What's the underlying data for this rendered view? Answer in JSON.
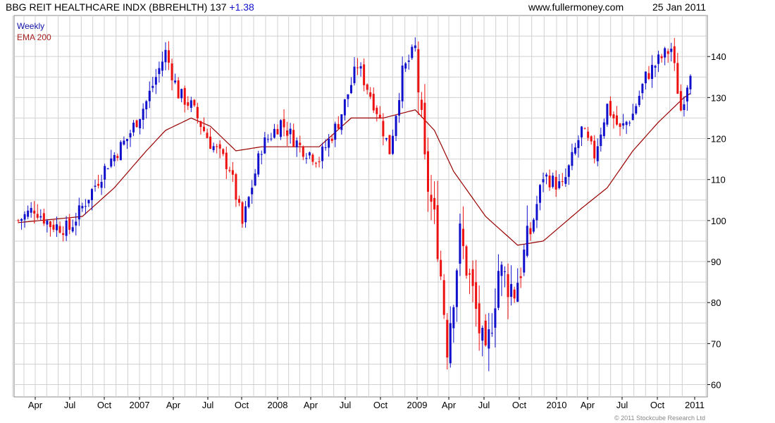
{
  "header": {
    "title": "BBG REIT HEALTHCARE INDX (BBREHLTH) 137",
    "change": "+1.38",
    "site": "www.fullermoney.com",
    "date": "25 Jan 2011"
  },
  "footer": {
    "copyright": "© 2011 Stockcube Research Ltd"
  },
  "colors": {
    "up": "#1010cc",
    "down": "#ee1111",
    "ema": "#990000",
    "grid": "#d0d0d0",
    "legend_weekly": "#1111aa",
    "legend_ema": "#aa2222"
  },
  "chart_data": {
    "type": "candlestick",
    "period": "Weekly",
    "legend": [
      {
        "label": "Weekly",
        "color": "#1111aa"
      },
      {
        "label": "EMA 200",
        "color": "#aa2222"
      }
    ],
    "y_ticks": [
      60,
      70,
      80,
      90,
      100,
      110,
      120,
      130,
      140
    ],
    "ylim": [
      57,
      150
    ],
    "x_tick_labels": [
      "Apr",
      "Jul",
      "Oct",
      "2007",
      "Apr",
      "Jul",
      "Oct",
      "2008",
      "Apr",
      "Jul",
      "Oct",
      "2009",
      "Apr",
      "Jul",
      "Oct",
      "2010",
      "Apr",
      "Jul",
      "Oct",
      "2011"
    ],
    "x_anchor_points": [
      {
        "week": 0,
        "close": 100
      },
      {
        "week": 5,
        "close": 103
      },
      {
        "week": 10,
        "close": 99
      },
      {
        "week": 16,
        "close": 98
      },
      {
        "week": 22,
        "close": 106
      },
      {
        "week": 28,
        "close": 114
      },
      {
        "week": 34,
        "close": 120
      },
      {
        "week": 40,
        "close": 129
      },
      {
        "week": 46,
        "close": 141
      },
      {
        "week": 50,
        "close": 131
      },
      {
        "week": 54,
        "close": 128
      },
      {
        "week": 60,
        "close": 119
      },
      {
        "week": 66,
        "close": 113
      },
      {
        "week": 70,
        "close": 99
      },
      {
        "week": 76,
        "close": 118
      },
      {
        "week": 82,
        "close": 124
      },
      {
        "week": 88,
        "close": 118
      },
      {
        "week": 94,
        "close": 115
      },
      {
        "week": 100,
        "close": 124
      },
      {
        "week": 106,
        "close": 138
      },
      {
        "week": 112,
        "close": 127
      },
      {
        "week": 116,
        "close": 117
      },
      {
        "week": 120,
        "close": 136
      },
      {
        "week": 124,
        "close": 142
      },
      {
        "week": 127,
        "close": 113
      },
      {
        "week": 131,
        "close": 95
      },
      {
        "week": 134,
        "close": 70
      },
      {
        "week": 138,
        "close": 96
      },
      {
        "week": 142,
        "close": 82
      },
      {
        "week": 146,
        "close": 65
      },
      {
        "week": 150,
        "close": 88
      },
      {
        "week": 155,
        "close": 83
      },
      {
        "week": 160,
        "close": 97
      },
      {
        "week": 164,
        "close": 111
      },
      {
        "week": 170,
        "close": 108
      },
      {
        "week": 176,
        "close": 122
      },
      {
        "week": 180,
        "close": 116
      },
      {
        "week": 184,
        "close": 128
      },
      {
        "week": 188,
        "close": 122
      },
      {
        "week": 192,
        "close": 126
      },
      {
        "week": 196,
        "close": 135
      },
      {
        "week": 200,
        "close": 139
      },
      {
        "week": 204,
        "close": 142
      },
      {
        "week": 207,
        "close": 127
      },
      {
        "week": 210,
        "close": 137
      }
    ],
    "ema_points": [
      {
        "week": 0,
        "value": 99.5
      },
      {
        "week": 20,
        "value": 101
      },
      {
        "week": 30,
        "value": 108
      },
      {
        "week": 40,
        "value": 117
      },
      {
        "week": 46,
        "value": 122
      },
      {
        "week": 54,
        "value": 125
      },
      {
        "week": 60,
        "value": 123
      },
      {
        "week": 68,
        "value": 117
      },
      {
        "week": 76,
        "value": 118
      },
      {
        "week": 86,
        "value": 118
      },
      {
        "week": 94,
        "value": 118
      },
      {
        "week": 104,
        "value": 125
      },
      {
        "week": 114,
        "value": 125
      },
      {
        "week": 124,
        "value": 127
      },
      {
        "week": 130,
        "value": 122
      },
      {
        "week": 136,
        "value": 112
      },
      {
        "week": 146,
        "value": 101
      },
      {
        "week": 156,
        "value": 94
      },
      {
        "week": 164,
        "value": 95
      },
      {
        "week": 176,
        "value": 103
      },
      {
        "week": 184,
        "value": 108
      },
      {
        "week": 192,
        "value": 117
      },
      {
        "week": 200,
        "value": 124
      },
      {
        "week": 208,
        "value": 130
      },
      {
        "week": 210,
        "value": 131
      }
    ],
    "weeks_total": 211
  }
}
